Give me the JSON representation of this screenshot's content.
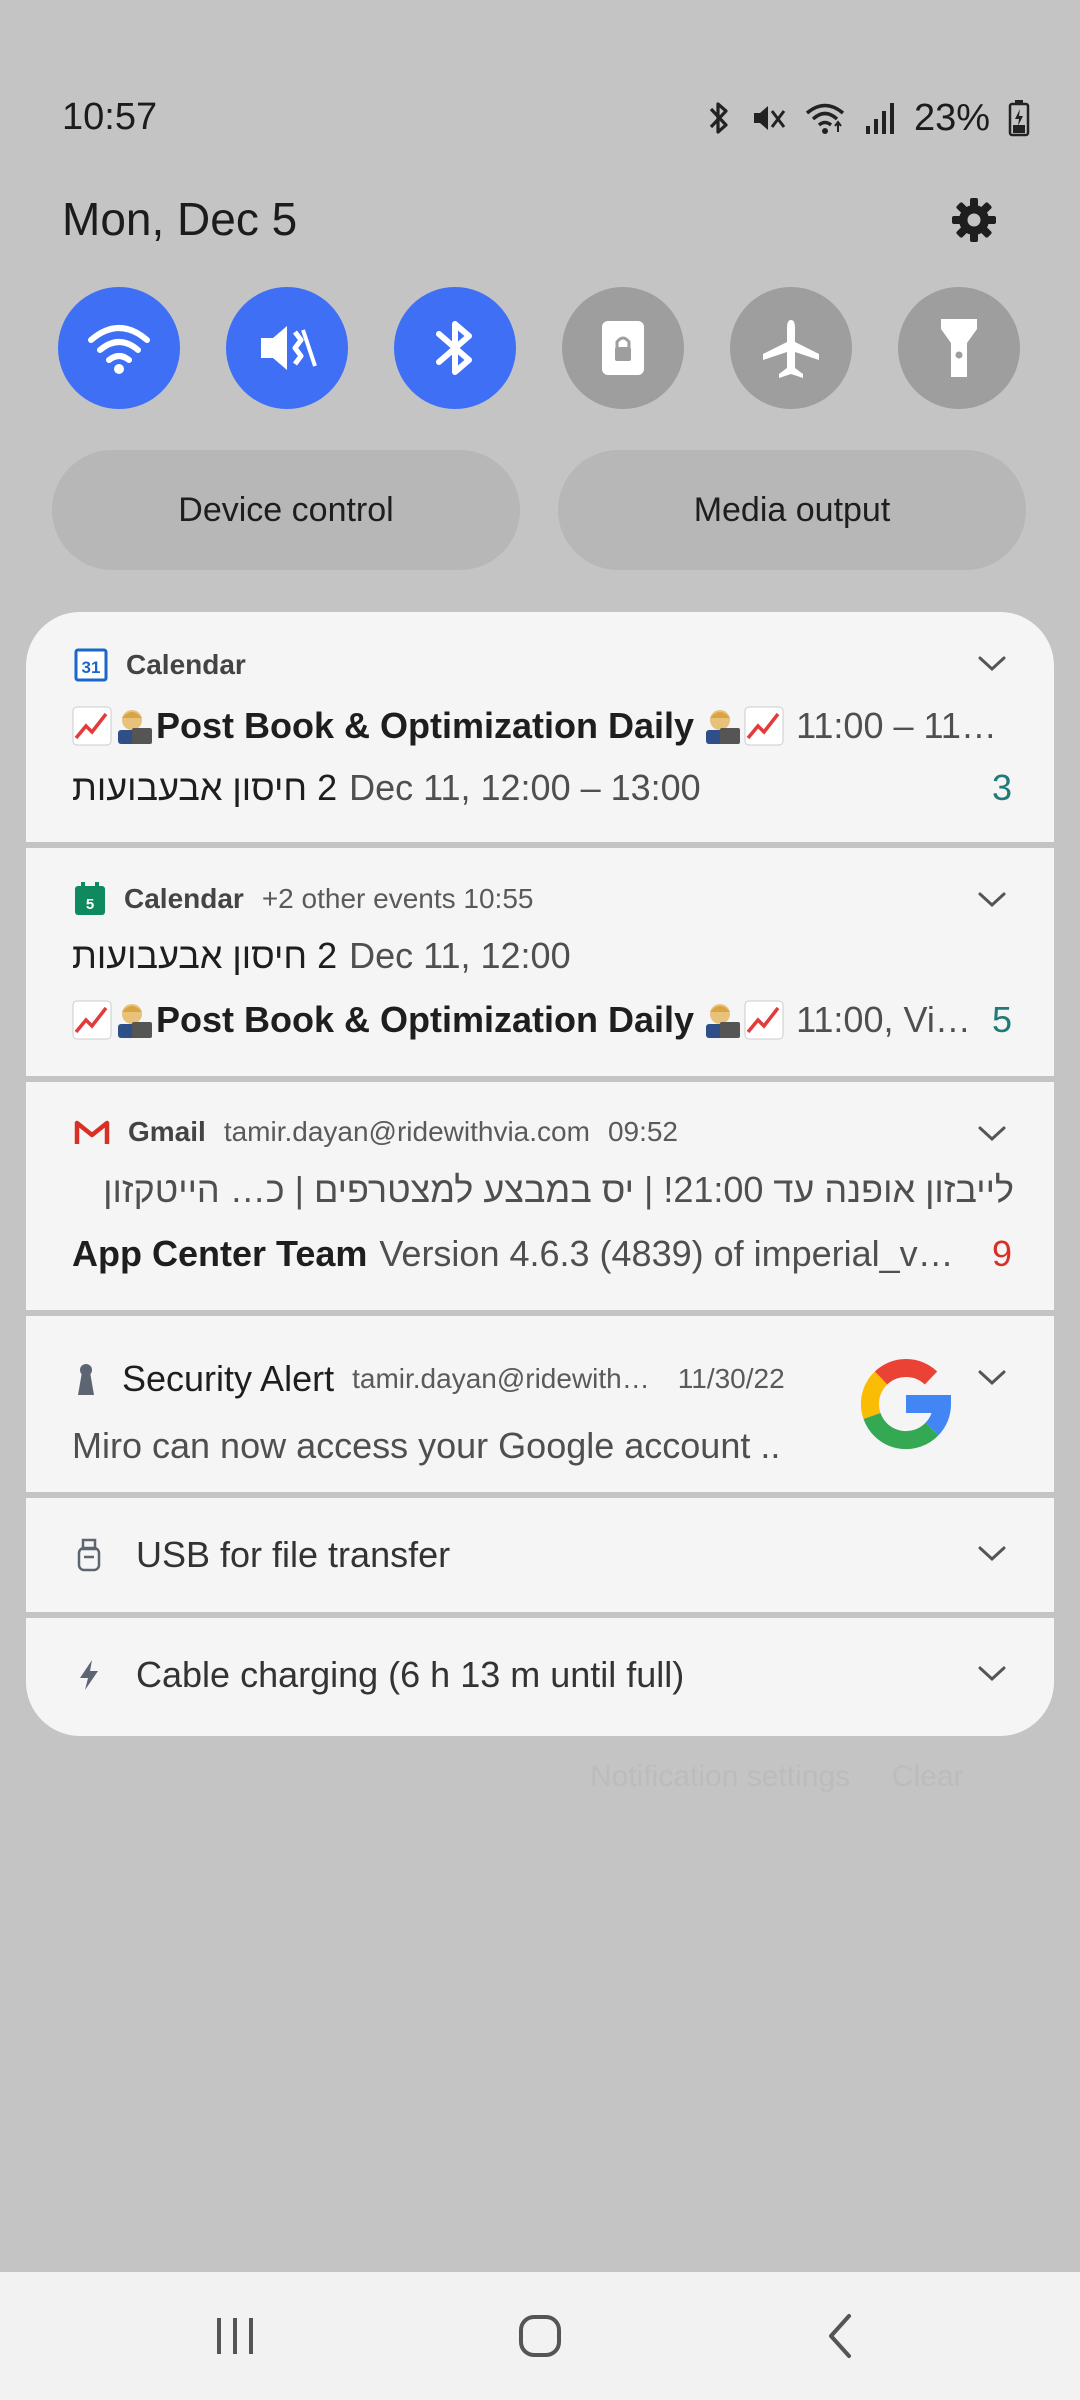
{
  "status_bar": {
    "time": "10:57",
    "battery": "23%",
    "icons": [
      "bluetooth-icon",
      "mute-icon",
      "wifi-icon",
      "signal-icon",
      "battery-icon"
    ]
  },
  "header": {
    "date": "Mon, Dec 5"
  },
  "quick_toggles": [
    {
      "name": "wifi",
      "icon": "wifi-icon",
      "state": "on"
    },
    {
      "name": "sound",
      "icon": "mute-icon",
      "state": "on"
    },
    {
      "name": "bluetooth",
      "icon": "bluetooth-icon",
      "state": "on"
    },
    {
      "name": "screen-lock",
      "icon": "lock-icon",
      "state": "off"
    },
    {
      "name": "airplane",
      "icon": "airplane-icon",
      "state": "off"
    },
    {
      "name": "flashlight",
      "icon": "flashlight-icon",
      "state": "off"
    }
  ],
  "buttons": {
    "device_control": "Device control",
    "media_output": "Media output"
  },
  "notifications": {
    "cal1": {
      "app": "Calendar",
      "line1_title": "Post Book & Optimization Daily",
      "line1_time": "11:00 – 11…",
      "line2_hebrew": "2 חיסון אבעבועות",
      "line2_detail": "Dec 11, 12:00 – 13:00",
      "count": "3"
    },
    "cal2": {
      "app": "Calendar",
      "meta": "+2 other events 10:55",
      "line1_hebrew": "2 חיסון אבעבועות",
      "line1_detail": "Dec 11, 12:00",
      "line2_title": "Post Book & Optimization Daily",
      "line2_time": "11:00, Vi…",
      "count": "5"
    },
    "gmail": {
      "app": "Gmail",
      "account": "tamir.dayan@ridewithvia.com",
      "time": "09:52",
      "line1": "לייבזון אופנה עד 21:00! | יס במבצע למצטרפים | כ… הייטקזון",
      "line2_sender": "App Center Team",
      "line2_text": "Version 4.6.3 (4839) of imperial_v…",
      "count": "9"
    },
    "security": {
      "title": "Security Alert",
      "account": "tamir.dayan@ridewith…",
      "date": "11/30/22",
      "text": "Miro can now access your Google account .."
    },
    "usb": {
      "text": "USB for file transfer"
    },
    "charging": {
      "text": "Cable charging (6 h 13 m until full)"
    }
  },
  "faded_text": "Notification settings     Clear",
  "colors": {
    "toggle_on": "#3e6ff5",
    "toggle_off": "#9e9e9e",
    "count_teal": "#1f7a78",
    "count_red": "#d93025"
  }
}
